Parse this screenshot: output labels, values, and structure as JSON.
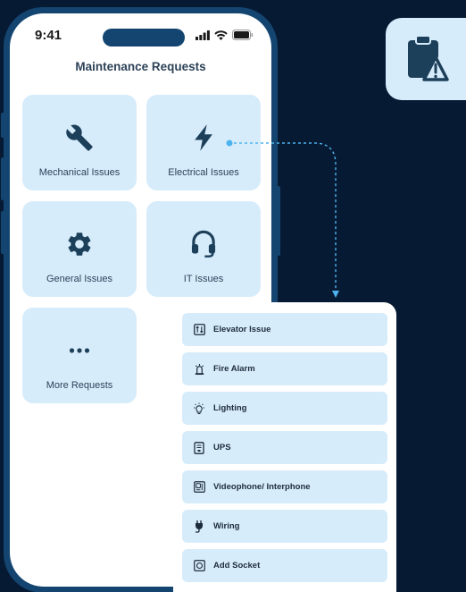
{
  "status_bar": {
    "time": "9:41"
  },
  "screen": {
    "title": "Maintenance Requests"
  },
  "categories": [
    {
      "label": "Mechanical Issues",
      "icon": "wrench-icon"
    },
    {
      "label": "Electrical Issues",
      "icon": "lightning-icon"
    },
    {
      "label": "General Issues",
      "icon": "gear-icon"
    },
    {
      "label": "IT Issues",
      "icon": "headset-icon"
    },
    {
      "label": "More Requests",
      "icon": "more-dots-icon"
    }
  ],
  "electrical_menu": {
    "items": [
      {
        "label": "Elevator Issue",
        "icon": "elevator-icon"
      },
      {
        "label": "Fire Alarm",
        "icon": "fire-alarm-icon"
      },
      {
        "label": "Lighting",
        "icon": "lightbulb-icon"
      },
      {
        "label": "UPS",
        "icon": "ups-icon"
      },
      {
        "label": "Videophone/ Interphone",
        "icon": "videophone-icon"
      },
      {
        "label": "Wiring",
        "icon": "plug-icon"
      },
      {
        "label": "Add Socket",
        "icon": "socket-icon"
      }
    ]
  },
  "badge": {
    "icon": "clipboard-alert-icon"
  },
  "colors": {
    "background": "#071a33",
    "phone_frame": "#134570",
    "tile": "#d7ecfb",
    "icon": "#1c3f5a",
    "accent": "#4db3ee"
  }
}
